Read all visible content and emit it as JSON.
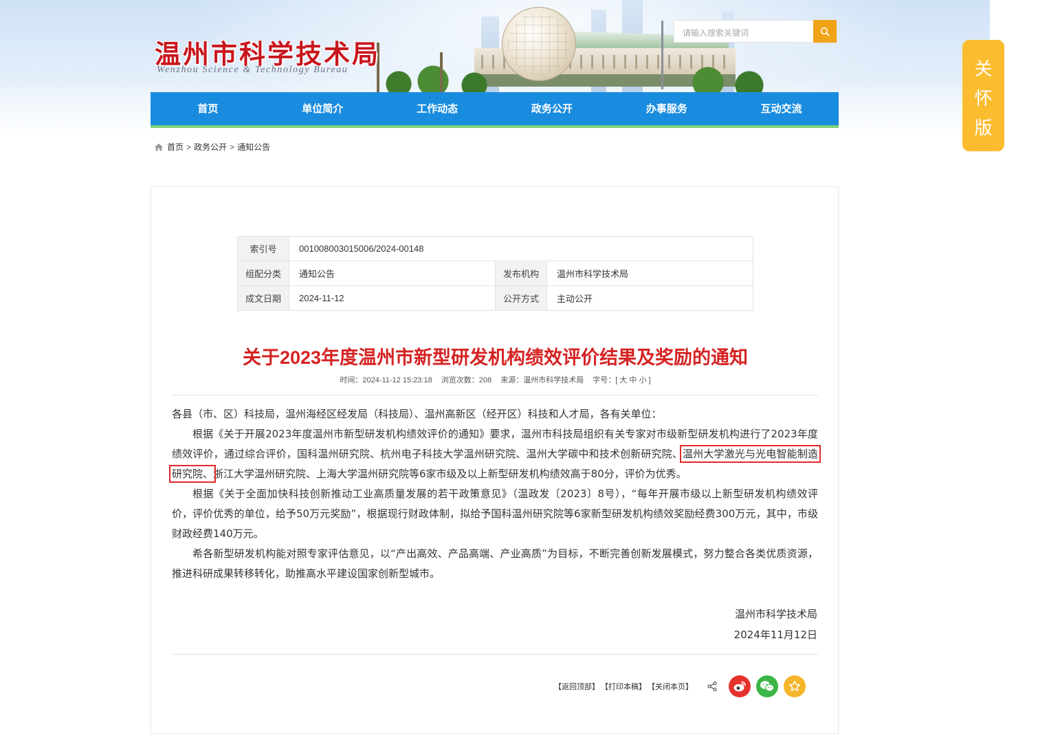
{
  "header": {
    "logo_cn": "温州市科学技术局",
    "logo_en": "Wenzhou Science & Technology Bureau",
    "search_placeholder": "请输入搜索关键词",
    "search_icon": "search-icon"
  },
  "nav": [
    "首页",
    "单位简介",
    "工作动态",
    "政务公开",
    "办事服务",
    "互动交流"
  ],
  "care_mode": [
    "关",
    "怀",
    "版"
  ],
  "breadcrumb": {
    "items": [
      "首页",
      "政务公开",
      "通知公告"
    ],
    "separator": ">"
  },
  "meta": {
    "index_label": "索引号",
    "index_value": "001008003015006/2024-00148",
    "category_label": "组配分类",
    "category_value": "通知公告",
    "publisher_label": "发布机构",
    "publisher_value": "温州市科学技术局",
    "date_label": "成文日期",
    "date_value": "2024-11-12",
    "open_label": "公开方式",
    "open_value": "主动公开"
  },
  "article": {
    "title": "关于2023年度温州市新型研发机构绩效评价结果及奖励的通知",
    "time": "时间：2024-11-12 15:23:18",
    "views": "浏览次数：208",
    "source": "来源：温州市科学技术局",
    "fontsize": "字号：[ 大 中 小 ]",
    "salutation": "各县（市、区）科技局，温州海经区经发局（科技局）、温州高新区（经开区）科技和人才局，各有关单位：",
    "p1_a": "根据《关于开展2023年度温州市新型研发机构绩效评价的通知》要求，温州市科技局组织有关专家对市级新型研发机构进行了2023年度绩效评价，通过综合评价，国科温州研究院、杭州电子科技大学温州研究院、温州大学碳中和技术创新研究院、",
    "p1_highlight": "温州大学激光与光电智能制造研究院、",
    "p1_b": "浙江大学温州研究院、上海大学温州研究院等6家市级及以上新型研发机构绩效高于80分，评价为优秀。",
    "p2": "根据《关于全面加快科技创新推动工业高质量发展的若干政策意见》（温政发〔2023〕8号），“每年开展市级以上新型研发机构绩效评价，评价优秀的单位，给予50万元奖励”，根据现行财政体制，拟给予国科温州研究院等6家新型研发机构绩效奖励经费300万元，其中，市级财政经费140万元。",
    "p3": "希各新型研发机构能对照专家评估意见，以“产出高效、产品高端、产业高质”为目标，不断完善创新发展模式，努力整合各类优质资源，推进科研成果转移转化，助推高水平建设国家创新型城市。",
    "sign_org": "温州市科学技术局",
    "sign_date": "2024年11月12日"
  },
  "tools": {
    "back_top": "【返回顶部】",
    "print": "【打印本稿】",
    "close": "【关闭本页】",
    "icons": [
      "share-icon",
      "weibo-icon",
      "wechat-icon",
      "favorite-icon"
    ]
  },
  "colors": {
    "nav_bg": "#1a8ce0",
    "nav_border": "#7ad27a",
    "title_red": "#d52222",
    "logo_red": "#c8161d",
    "care_bg": "#fbbd2f",
    "search_btn": "#f0a316",
    "highlight_box": "#e02a2a"
  }
}
